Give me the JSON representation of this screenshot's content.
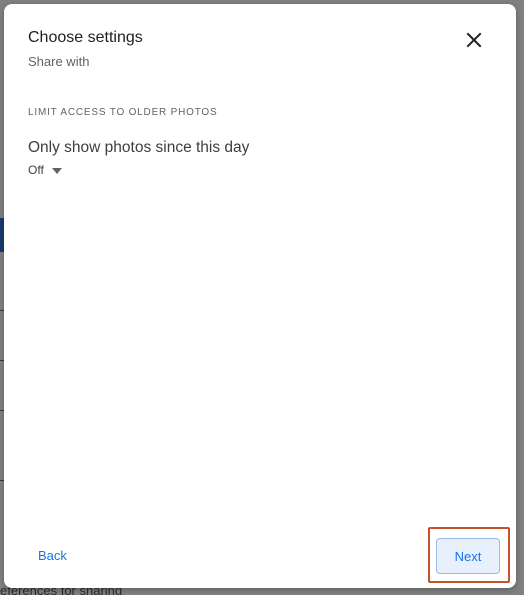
{
  "background": {
    "partial_text": "eferences for sharing"
  },
  "dialog": {
    "title": "Choose settings",
    "subtitle": "Share with",
    "close_icon": "close-icon"
  },
  "section": {
    "header": "LIMIT ACCESS TO OLDER PHOTOS",
    "option_label": "Only show photos since this day",
    "dropdown_value": "Off",
    "dropdown_icon": "caret-down-icon"
  },
  "footer": {
    "back_label": "Back",
    "next_label": "Next",
    "highlight_color": "#c5522b"
  },
  "colors": {
    "accent": "#1a73e8",
    "title_text": "#202124",
    "secondary_text": "#5f6368"
  }
}
